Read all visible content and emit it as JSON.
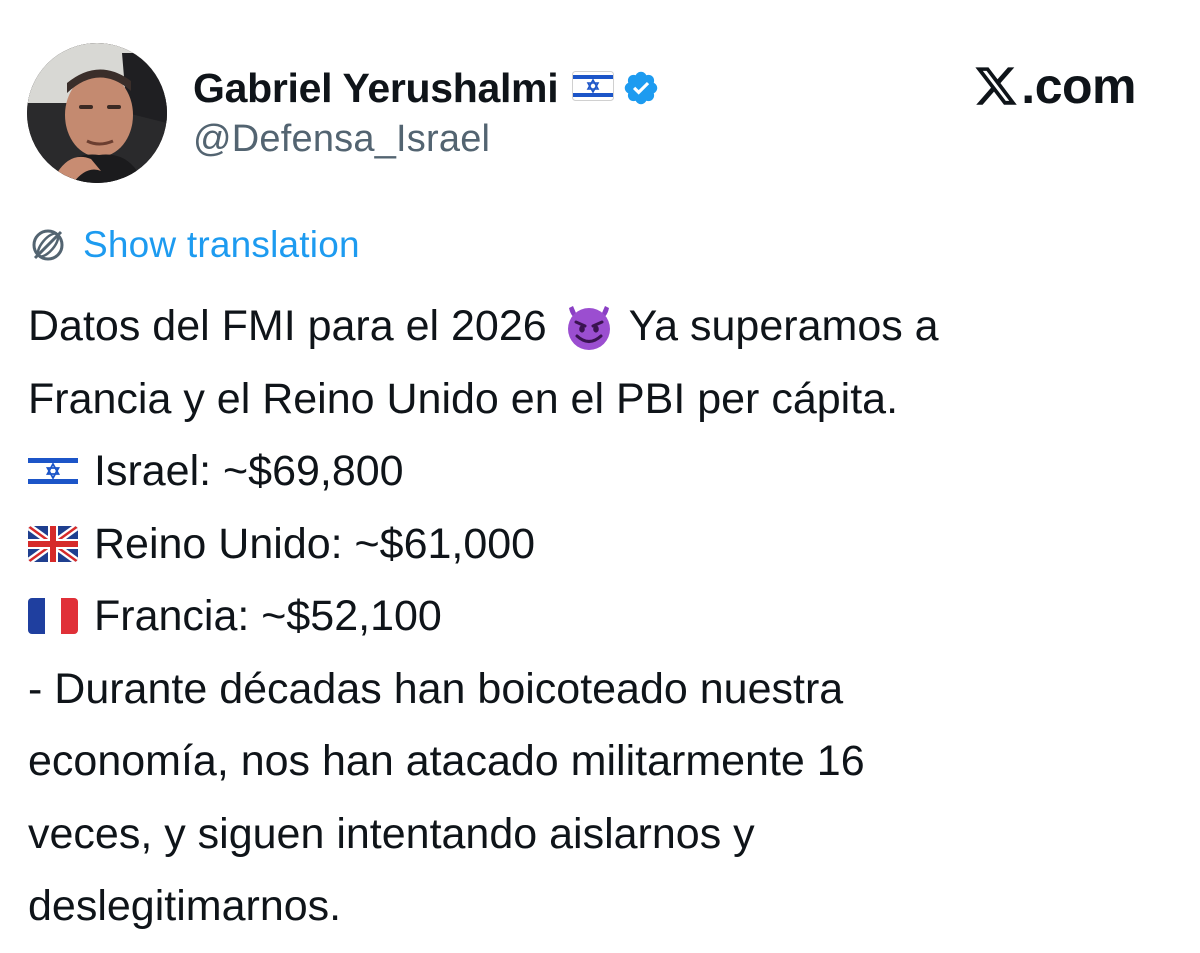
{
  "author": {
    "display_name": "Gabriel Yerushalmi",
    "handle": "@Defensa_Israel",
    "flag_icon": "israel-flag-icon",
    "verified_icon": "verified-badge-icon"
  },
  "brand": {
    "label": ".com",
    "logo_icon": "x-logo-icon"
  },
  "translation": {
    "label": "Show translation",
    "icon": "globe-icon"
  },
  "post": {
    "line1_a": "Datos del FMI para el 2026",
    "line1_emoji": "smiling-devil-emoji",
    "line1_b": "Ya superamos a",
    "line2": "Francia y el Reino Unido en el PBI per cápita.",
    "items": [
      {
        "flag": "israel-flag-icon",
        "text": "Israel: ~$69,800"
      },
      {
        "flag": "uk-flag-icon",
        "text": "Reino Unido: ~$61,000"
      },
      {
        "flag": "france-flag-icon",
        "text": "Francia: ~$52,100"
      }
    ],
    "closing": [
      "- Durante décadas han boicoteado nuestra",
      "economía, nos han atacado militarmente 16",
      "veces, y siguen intentando aislarnos y",
      "deslegitimarnos."
    ]
  },
  "colors": {
    "text": "#0f1419",
    "secondary": "#536471",
    "link": "#1d9bf0",
    "verified": "#1d9bf0"
  }
}
